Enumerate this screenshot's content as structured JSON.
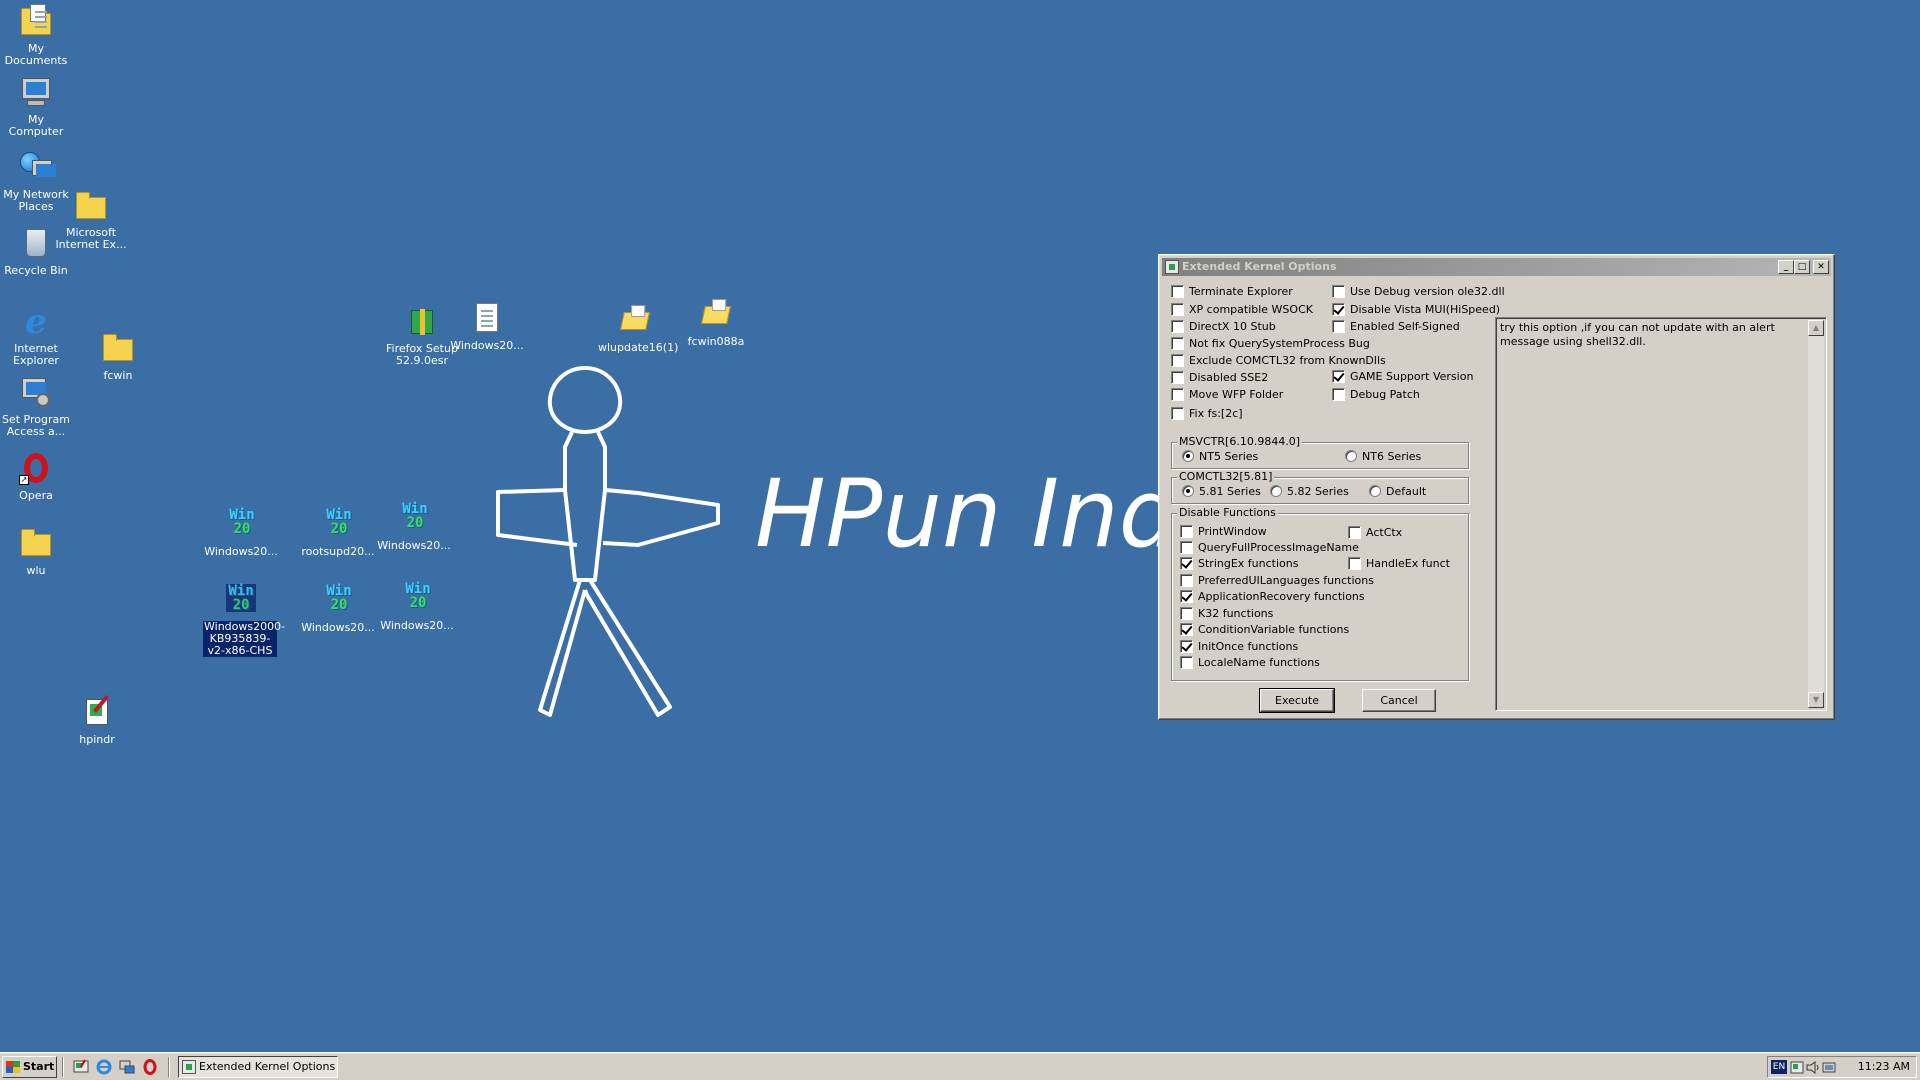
{
  "desktop": {
    "background_color": "#3a6ea5",
    "wallpaper_text": "HPun Indu",
    "icons": [
      {
        "label": "My Documents",
        "icon": "my-documents-icon"
      },
      {
        "label": "My Computer",
        "icon": "my-computer-icon"
      },
      {
        "label": "My Network Places",
        "icon": "network-places-icon"
      },
      {
        "label": "Microsoft Internet Ex...",
        "icon": "folder-icon"
      },
      {
        "label": "Recycle Bin",
        "icon": "recycle-bin-icon"
      },
      {
        "label": "Internet Explorer",
        "icon": "internet-explorer-icon"
      },
      {
        "label": "fcwin",
        "icon": "folder-icon"
      },
      {
        "label": "Set Program Access a...",
        "icon": "set-program-access-icon"
      },
      {
        "label": "Opera",
        "icon": "opera-icon"
      },
      {
        "label": "wlu",
        "icon": "folder-icon"
      },
      {
        "label": "hpindr",
        "icon": "notes-icon"
      },
      {
        "label": "Firefox Setup 52.9.0esr",
        "icon": "installer-icon"
      },
      {
        "label": "Windows20...",
        "icon": "document-icon"
      },
      {
        "label": "wlupdate16(1)",
        "icon": "folder-open-icon"
      },
      {
        "label": "fcwin088a",
        "icon": "folder-open-icon"
      },
      {
        "label": "Windows20...",
        "icon": "win2000-update-icon"
      },
      {
        "label": "rootsupd20...",
        "icon": "win2000-update-icon"
      },
      {
        "label": "Windows20...",
        "icon": "win2000-update-icon"
      },
      {
        "label": "Windows2000-KB935839-v2-x86-CHS",
        "icon": "win2000-update-icon",
        "selected": true
      },
      {
        "label": "Windows20...",
        "icon": "win2000-update-icon"
      },
      {
        "label": "Windows20...",
        "icon": "win2000-update-icon"
      }
    ]
  },
  "window": {
    "title": "Extended Kernel Options",
    "left_options": [
      {
        "label": "Terminate Explorer",
        "checked": false
      },
      {
        "label": "XP compatible WSOCK",
        "checked": false
      },
      {
        "label": "DirectX 10 Stub",
        "checked": false
      },
      {
        "label": "Not fix QuerySystemProcess Bug",
        "checked": false
      },
      {
        "label": "Exclude COMCTL32 from KnownDlls",
        "checked": false
      },
      {
        "label": "Disabled SSE2",
        "checked": false
      },
      {
        "label": "Move WFP Folder",
        "checked": false
      },
      {
        "label": "Fix fs:[2c]",
        "checked": false
      }
    ],
    "right_options": [
      {
        "label": "Use Debug version ole32.dll",
        "checked": false
      },
      {
        "label": "Disable Vista MUI(HiSpeed)",
        "checked": true
      },
      {
        "label": "Enabled Self-Signed",
        "checked": false
      },
      {
        "label": "GAME Support Version",
        "checked": true
      },
      {
        "label": "Debug Patch",
        "checked": false
      }
    ],
    "msvctr": {
      "title": "MSVCTR[6.10.9844.0]",
      "options": [
        {
          "label": "NT5 Series",
          "selected": true
        },
        {
          "label": "NT6 Series",
          "selected": false
        }
      ]
    },
    "comctl32": {
      "title": "COMCTL32[5.81]",
      "options": [
        {
          "label": "5.81 Series",
          "selected": true
        },
        {
          "label": "5.82 Series",
          "selected": false
        },
        {
          "label": "Default",
          "selected": false
        }
      ]
    },
    "disable_functions": {
      "title": "Disable Functions",
      "items": [
        {
          "label": "PrintWindow",
          "checked": false
        },
        {
          "label": "QueryFullProcessImageName",
          "checked": false
        },
        {
          "label": "StringEx functions",
          "checked": true
        },
        {
          "label": "PreferredUILanguages functions",
          "checked": false
        },
        {
          "label": "ApplicationRecovery functions",
          "checked": true
        },
        {
          "label": "K32 functions",
          "checked": false
        },
        {
          "label": "ConditionVariable functions",
          "checked": true
        },
        {
          "label": "InitOnce functions",
          "checked": true
        },
        {
          "label": "LocaleName functions",
          "checked": false
        }
      ],
      "side_items": [
        {
          "label": "ActCtx",
          "checked": false
        },
        {
          "label": "HandleEx funct",
          "checked": false
        }
      ]
    },
    "execute_label": "Execute",
    "cancel_label": "Cancel",
    "description": "try this option ,if you can not update with an alert message using shell32.dll."
  },
  "taskbar": {
    "start_label": "Start",
    "task_label": "Extended Kernel Options",
    "lang": "EN",
    "clock": "11:23 AM"
  }
}
